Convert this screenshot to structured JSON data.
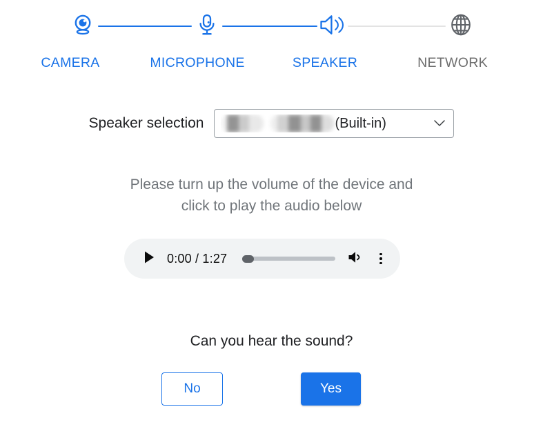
{
  "stepper": {
    "steps": [
      {
        "label": "CAMERA",
        "icon": "camera-icon",
        "state": "active"
      },
      {
        "label": "MICROPHONE",
        "icon": "microphone-icon",
        "state": "active"
      },
      {
        "label": "SPEAKER",
        "icon": "speaker-icon",
        "state": "active"
      },
      {
        "label": "NETWORK",
        "icon": "globe-icon",
        "state": "inactive"
      }
    ],
    "active_color": "#1a73e8",
    "inactive_color": "#6e6e6e",
    "connector_active_color": "#1a73e8",
    "connector_inactive_color": "#e3e3e3"
  },
  "speaker_selection": {
    "label": "Speaker selection",
    "value_suffix": "(Built-in)",
    "value_redacted": true,
    "chevron_icon": "chevron-down-icon"
  },
  "instruction": {
    "line1": "Please turn up the volume of the device and",
    "line2": "click to play the audio below"
  },
  "audio_player": {
    "play_icon": "play-icon",
    "current_time": "0:00",
    "duration": "1:27",
    "time_display": "0:00 / 1:27",
    "progress_percent": 0,
    "volume_icon": "volume-icon",
    "more_icon": "more-vertical-icon"
  },
  "question": {
    "text": "Can you hear the sound?",
    "no_label": "No",
    "yes_label": "Yes",
    "yes_color": "#1a73e8",
    "no_color": "#1a73e8"
  }
}
